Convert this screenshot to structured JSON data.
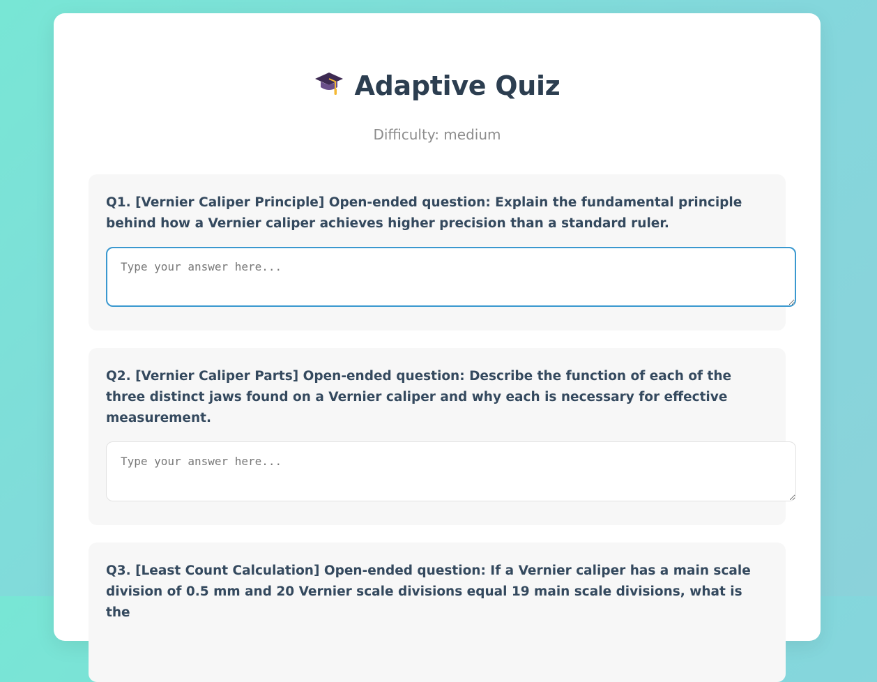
{
  "header": {
    "icon": "graduation-cap-icon",
    "title": "Adaptive Quiz",
    "subtitle": "Difficulty: medium"
  },
  "questions": [
    {
      "text": "Q1. [Vernier Caliper Principle] Open-ended question: Explain the fundamental principle behind how a Vernier caliper achieves higher precision than a standard ruler.",
      "placeholder": "Type your answer here...",
      "value": "",
      "focused": true
    },
    {
      "text": "Q2. [Vernier Caliper Parts] Open-ended question: Describe the function of each of the three distinct jaws found on a Vernier caliper and why each is necessary for effective measurement.",
      "placeholder": "Type your answer here...",
      "value": "",
      "focused": false
    },
    {
      "text": "Q3. [Least Count Calculation] Open-ended question: If a Vernier caliper has a main scale division of 0.5 mm and 20 Vernier scale divisions equal 19 main scale divisions, what is the",
      "placeholder": "",
      "value": "",
      "focused": false
    }
  ],
  "colors": {
    "background_start": "#78e6d5",
    "background_end": "#8bd2da",
    "card": "#ffffff",
    "question_bg": "#f7f7f7",
    "heading": "#2c3e50",
    "question_text": "#34495e",
    "focus_border": "#3a98cf"
  }
}
